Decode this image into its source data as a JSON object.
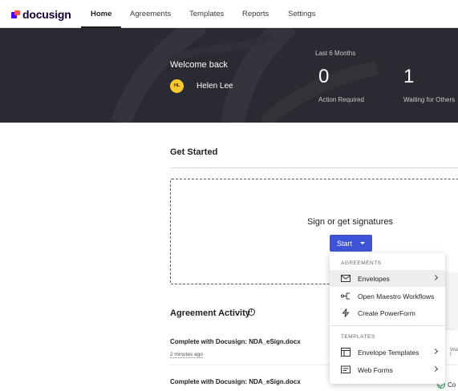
{
  "brand": {
    "name": "docusign"
  },
  "nav": {
    "tabs": [
      {
        "label": "Home",
        "active": true
      },
      {
        "label": "Agreements",
        "active": false
      },
      {
        "label": "Templates",
        "active": false
      },
      {
        "label": "Reports",
        "active": false
      },
      {
        "label": "Settings",
        "active": false
      }
    ]
  },
  "hero": {
    "welcome": "Welcome back",
    "user": {
      "initials": "HL",
      "name": "Helen Lee"
    },
    "period": "Last 6 Months",
    "stats": [
      {
        "value": "0",
        "label": "Action Required"
      },
      {
        "value": "1",
        "label": "Waiting for Others"
      }
    ]
  },
  "get_started": {
    "title": "Get Started",
    "dropzone_title": "Sign or get signatures",
    "start_button": "Start"
  },
  "menu": {
    "agreements_header": "AGREEMENTS",
    "agreements_items": [
      {
        "label": "Envelopes",
        "icon": "envelope-icon",
        "submenu": true
      },
      {
        "label": "Open Maestro Workflows",
        "icon": "workflow-icon",
        "submenu": false
      },
      {
        "label": "Create PowerForm",
        "icon": "lightning-icon",
        "submenu": false
      }
    ],
    "templates_header": "TEMPLATES",
    "templates_items": [
      {
        "label": "Envelope Templates",
        "icon": "layout-icon",
        "submenu": true
      },
      {
        "label": "Web Forms",
        "icon": "web-form-icon",
        "submenu": true
      }
    ]
  },
  "activity": {
    "title": "Agreement Activity",
    "items": [
      {
        "title": "Complete with Docusign: NDA_eSign.docx",
        "time": "2 minutes ago",
        "status": "Waiting f"
      },
      {
        "title": "Complete with Docusign: NDA_eSign.docx",
        "status": "Co"
      }
    ]
  },
  "colors": {
    "hero_bg": "#2a2a32",
    "primary_button": "#3d54d6",
    "avatar": "#f7c82e",
    "success": "#1f8a4c"
  }
}
